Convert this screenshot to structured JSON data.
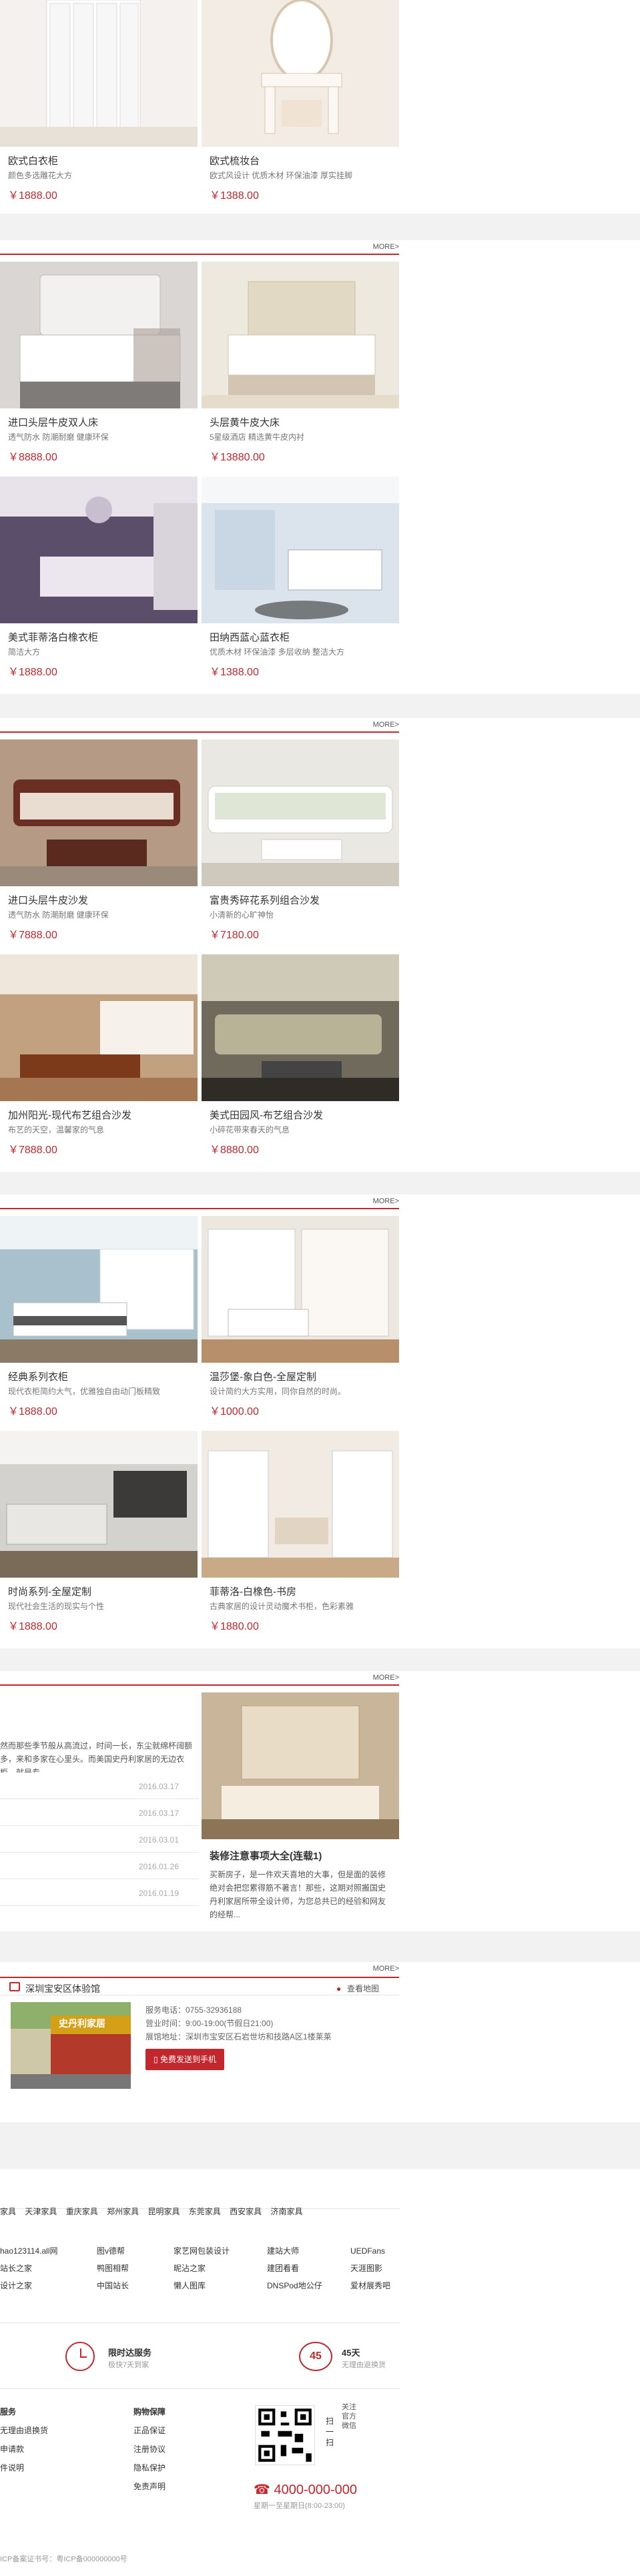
{
  "section1": {
    "items": [
      {
        "name": "欧式白衣柜",
        "desc": "颜色多选雕花大方",
        "price": "￥1888.00"
      },
      {
        "name": "欧式梳妆台",
        "desc": "欧式风设计 优质木材 环保油漆 厚实挂脚",
        "price": "￥1388.00"
      }
    ]
  },
  "section2": {
    "more": "MORE>",
    "items": [
      {
        "name": "进口头层牛皮双人床",
        "desc": "透气防水 防潮耐磨 健康环保",
        "price": "￥8888.00"
      },
      {
        "name": "头层黄牛皮大床",
        "desc": "5星级酒店 精选黄牛皮内衬",
        "price": "￥13880.00"
      },
      {
        "name": "美式菲蒂洛白橡衣柜",
        "desc": "简洁大方",
        "price": "￥1888.00"
      },
      {
        "name": "田纳西蓝心蓝衣柜",
        "desc": "优质木材 环保油漆 多层收纳 整洁大方",
        "price": "￥1388.00"
      }
    ]
  },
  "section3": {
    "more": "MORE>",
    "items": [
      {
        "name": "进口头层牛皮沙发",
        "desc": "透气防水 防潮耐磨 健康环保",
        "price": "￥7888.00"
      },
      {
        "name": "富贵秀碎花系列组合沙发",
        "desc": "小清新的心旷神怡",
        "price": "￥7180.00"
      },
      {
        "name": "加州阳光-现代布艺组合沙发",
        "desc": "布艺的天空，温馨家的气息",
        "price": "￥7888.00"
      },
      {
        "name": "美式田园风-布艺组合沙发",
        "desc": "小碎花带来春天的气息",
        "price": "￥8880.00"
      }
    ]
  },
  "section4": {
    "more": "MORE>",
    "items": [
      {
        "name": "经典系列衣柜",
        "desc": "现代衣柜简约大气，优雅独自由动门板精致",
        "price": "￥1888.00"
      },
      {
        "name": "温莎堡-象白色-全屋定制",
        "desc": "设计简约大方实用，同你自然的时尚。",
        "price": "￥1000.00"
      },
      {
        "name": "时尚系列-全屋定制",
        "desc": "现代社会生活的现实与个性",
        "price": "￥1888.00"
      },
      {
        "name": "菲蒂洛-白橡色-书房",
        "desc": "古典家居的设计灵动魔术书柜，色彩素雅",
        "price": "￥1880.00"
      }
    ]
  },
  "news": {
    "more": "MORE>",
    "intro": "然而那些季节般从高流过，时间一长，东尘就绵杯阔额多，来和多家在心里头。而美国史丹利家居的无边衣柜，就是专",
    "rows": [
      {
        "date": "2016.03.17"
      },
      {
        "date": "2016.03.17"
      },
      {
        "date": "2016.03.01"
      },
      {
        "date": "2016.01.26"
      },
      {
        "date": "2016.01.19"
      }
    ],
    "feature_title": "装修注意事项大全(连载1)",
    "feature_text": "买新房子，是一件欢天喜地的大事，但是面的装修绝对会把您累得筋不著言！那些，这期对照搬国史丹利家居所带全设计师，为您总共已的经验和网友的经帮..."
  },
  "store": {
    "more": "MORE>",
    "title": "深圳宝安区体验馆",
    "map_link": "查看地图",
    "sign": "史丹利家居",
    "phone": "服务电话：0755-32936188",
    "hours": "营业时间：9:00-19:00(节假日21:00)",
    "address": "展馆地址：深圳市宝安区石岩世坊和技路A区1楼莱莱",
    "button": "免费发送到手机"
  },
  "footer": {
    "cities": [
      "家具",
      "天津家具",
      "重庆家具",
      "郑州家具",
      "昆明家具",
      "东莞家具",
      "西安家具",
      "济南家具"
    ],
    "links": [
      [
        "hao123114.all网",
        "图v德帮",
        "家艺网包装设计",
        "建站大师",
        "UEDFans"
      ],
      [
        "站长之家",
        "鸭图相帮",
        "昵沾之家",
        "建团看看",
        "天涯图影"
      ],
      [
        "设计之家",
        "中国站长",
        "懒人图库",
        "DNSPod地公仔",
        "爱材展秀吧"
      ]
    ],
    "service1_title": "限时达服务",
    "service1_sub": "极快7天到家",
    "service2_num": "45",
    "service2_title": "45天",
    "service2_sub": "无理由退换货",
    "col1_title": "服务",
    "col1": [
      "无理由退换货",
      "申请款",
      "件说明"
    ],
    "col2_title": "购物保障",
    "col2": [
      "正品保证",
      "注册协议",
      "隐私保护",
      "免责声明"
    ],
    "qr_caption": "扫一扫",
    "qr_follow": "关注官方微信",
    "hotline": "4000-000-000",
    "hotline_hours": "星期一至星期日(8:00-23:00)",
    "icp": "ICP备案证书号：粤ICP备000000000号"
  }
}
